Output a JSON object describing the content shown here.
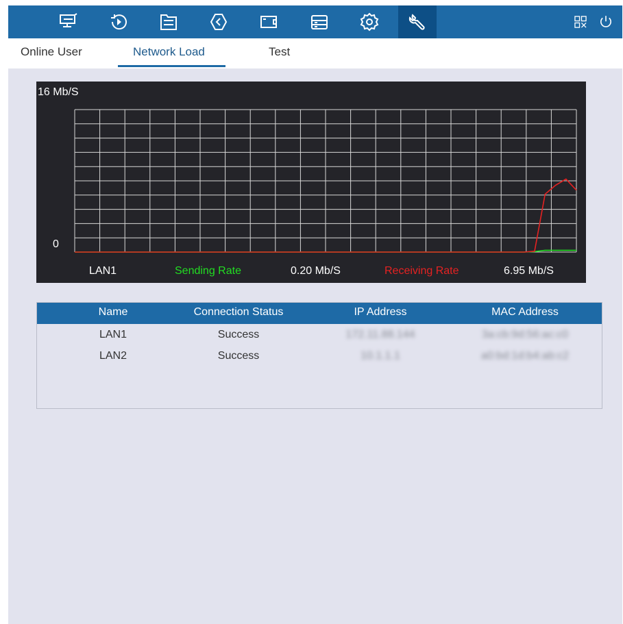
{
  "nav": {
    "icons": [
      {
        "name": "live-view-icon"
      },
      {
        "name": "playback-icon"
      },
      {
        "name": "file-icon"
      },
      {
        "name": "smart-icon"
      },
      {
        "name": "camera-icon"
      },
      {
        "name": "storage-icon"
      },
      {
        "name": "settings-icon"
      },
      {
        "name": "maintenance-icon"
      }
    ],
    "active_index": 7,
    "right_icons": [
      "qr-code-icon",
      "power-icon"
    ],
    "colors": {
      "bar": "#1e6aa6",
      "active": "#0d4f86"
    }
  },
  "tabs": {
    "items": [
      "Online User",
      "Network Load",
      "Test"
    ],
    "active": "Network Load"
  },
  "chart_data": {
    "type": "line",
    "y_max_label": "16 Mb/S",
    "y_min_label": "0",
    "ylim": [
      0,
      16
    ],
    "grid": true,
    "series": [
      {
        "name": "Sending Rate",
        "color": "#22dd22",
        "values": [
          0,
          0,
          0,
          0,
          0,
          0,
          0,
          0,
          0,
          0,
          0,
          0,
          0,
          0,
          0,
          0,
          0,
          0,
          0,
          0,
          0,
          0,
          0,
          0,
          0,
          0,
          0,
          0,
          0,
          0,
          0,
          0,
          0,
          0,
          0,
          0,
          0,
          0,
          0,
          0,
          0,
          0,
          0,
          0,
          0.05,
          0.2,
          0.2,
          0.2,
          0.2
        ]
      },
      {
        "name": "Receiving Rate",
        "color": "#e52222",
        "values": [
          0,
          0,
          0,
          0,
          0,
          0,
          0,
          0,
          0,
          0,
          0,
          0,
          0,
          0,
          0,
          0,
          0,
          0,
          0,
          0,
          0,
          0,
          0,
          0,
          0,
          0,
          0,
          0,
          0,
          0,
          0,
          0,
          0,
          0,
          0,
          0,
          0,
          0,
          0,
          0,
          0,
          0,
          0,
          0,
          0.1,
          6.5,
          7.5,
          8.2,
          6.95
        ]
      }
    ],
    "legend": {
      "interface": "LAN1",
      "sending_label": "Sending Rate",
      "sending_value": "0.20 Mb/S",
      "receiving_label": "Receiving Rate",
      "receiving_value": "6.95 Mb/S"
    }
  },
  "table": {
    "columns": [
      "Name",
      "Connection Status",
      "IP Address",
      "MAC Address"
    ],
    "rows": [
      {
        "name": "LAN1",
        "status": "Success",
        "ip": "172.11.88.144",
        "mac": "3a:cb:9d:56:ac:c0"
      },
      {
        "name": "LAN2",
        "status": "Success",
        "ip": "10.1.1.1",
        "mac": "a0:bd:1d:b4:ab:c2"
      }
    ]
  }
}
